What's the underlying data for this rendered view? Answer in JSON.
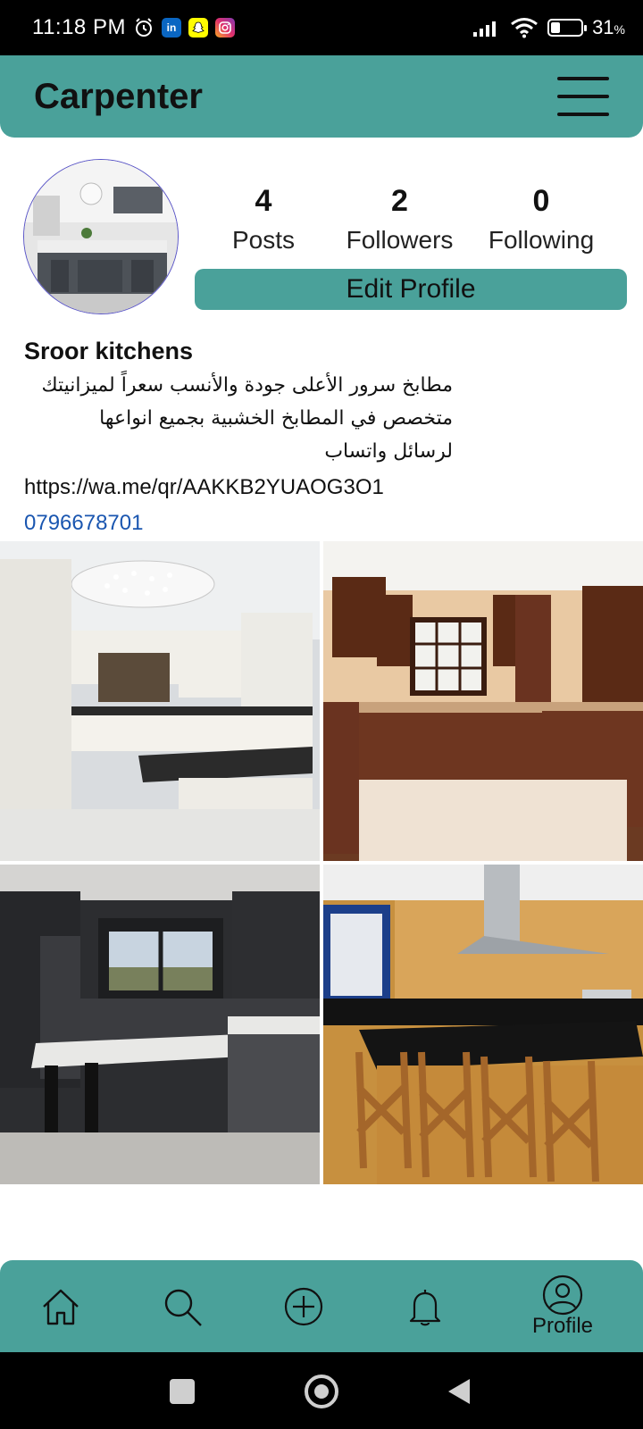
{
  "status_bar": {
    "time": "11:18 PM",
    "battery": "31",
    "battery_unit": "%",
    "battery_level": 0.31,
    "icons": [
      "alarm-icon",
      "linkedin-icon",
      "snapchat-icon",
      "instagram-icon",
      "signal-icon",
      "wifi-icon",
      "battery-icon"
    ]
  },
  "app_bar": {
    "title": "Carpenter",
    "menu_icon": "hamburger-menu-icon"
  },
  "profile": {
    "stats": [
      {
        "value": "4",
        "label": "Posts"
      },
      {
        "value": "2",
        "label": "Followers"
      },
      {
        "value": "0",
        "label": "Following"
      }
    ],
    "edit_label": "Edit Profile",
    "name": "Sroor kitchens",
    "bio_lines": [
      "مطابخ سرور الأعلى جودة والأنسب سعراً لميزانيتك",
      "متخصص في المطابخ الخشبية بجميع انواعها",
      "لرسائل واتساب"
    ],
    "link": "https://wa.me/qr/AAKKB2YUAOG3O1",
    "phone": "0796678701"
  },
  "posts": [
    {
      "name": "white-kitchen-post"
    },
    {
      "name": "wood-kitchen-post"
    },
    {
      "name": "dark-kitchen-post"
    },
    {
      "name": "island-kitchen-post"
    }
  ],
  "bottom_nav": {
    "items": [
      {
        "icon": "home-icon"
      },
      {
        "icon": "search-icon"
      },
      {
        "icon": "add-icon"
      },
      {
        "icon": "bell-icon"
      },
      {
        "icon": "profile-icon",
        "label": "Profile"
      }
    ]
  },
  "colors": {
    "accent": "#4aa19a",
    "link": "#1a56b0",
    "status_bar": "#000000"
  }
}
